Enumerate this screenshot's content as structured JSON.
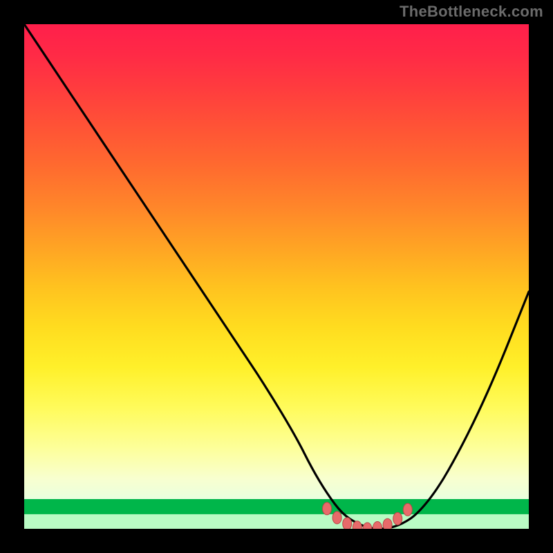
{
  "watermark": "TheBottleneck.com",
  "colors": {
    "background": "#000000",
    "watermark_text": "#6b6b6b",
    "curve_stroke": "#000000",
    "marker_fill": "#e86a6a",
    "marker_stroke": "#b84848",
    "gradient_top": "#ff1f4b",
    "gradient_mid": "#ffe81f",
    "gradient_bottom": "#00b64a"
  },
  "chart_data": {
    "type": "line",
    "title": "",
    "xlabel": "",
    "ylabel": "",
    "xlim": [
      0,
      100
    ],
    "ylim": [
      0,
      100
    ],
    "grid": false,
    "legend": false,
    "series": [
      {
        "name": "bottleneck-curve",
        "x": [
          0,
          6,
          12,
          18,
          24,
          30,
          36,
          42,
          48,
          54,
          57,
          60,
          63,
          66,
          69,
          72,
          75,
          78,
          82,
          86,
          90,
          94,
          98,
          100
        ],
        "y": [
          100,
          91,
          82,
          73,
          64,
          55,
          46,
          37,
          28,
          18,
          12,
          7,
          3,
          1,
          0,
          0,
          1,
          3,
          8,
          15,
          23,
          32,
          42,
          47
        ]
      }
    ],
    "markers": {
      "name": "optimal-range",
      "x": [
        60,
        62,
        64,
        66,
        68,
        70,
        72,
        74,
        76
      ],
      "y": [
        4.0,
        2.2,
        1.0,
        0.3,
        0.0,
        0.2,
        0.8,
        2.0,
        3.8
      ]
    },
    "annotations": []
  }
}
